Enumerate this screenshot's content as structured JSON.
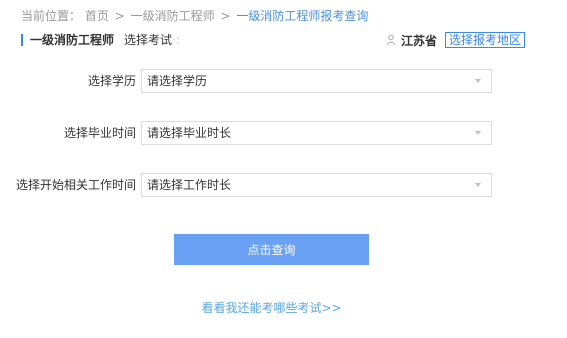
{
  "breadcrumb": {
    "prefix": "当前位置：",
    "home": "首页",
    "separator": ">",
    "level1": "一级消防工程师",
    "current": "一级消防工程师报考查询"
  },
  "header": {
    "exam_title": "一级消防工程师",
    "choose_exam": "选择考试",
    "choose_exam_dots": "·:",
    "province": "江苏省",
    "choose_region": "选择报考地区"
  },
  "form": {
    "education": {
      "label": "选择学历",
      "value": "请选择学历"
    },
    "graduation": {
      "label": "选择毕业时间",
      "value": "请选择毕业时长"
    },
    "work_start": {
      "label": "选择开始相关工作时间",
      "value": "请选择工作时长"
    }
  },
  "actions": {
    "query_label": "点击查询",
    "exam_link": "看看我还能考哪些考试>>"
  },
  "icons": {
    "location": "location-icon",
    "dropdown": "chevron-down-icon"
  },
  "colors": {
    "accent": "#3a86f5",
    "button": "#6aa1f5",
    "link": "#5aa7e8",
    "muted": "#999999"
  }
}
